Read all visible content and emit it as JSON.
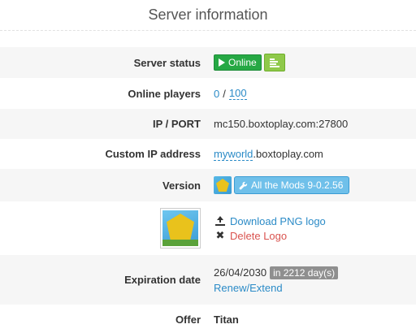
{
  "page_title": "Server information",
  "rows": {
    "server_status": {
      "label": "Server status",
      "status_text": "Online"
    },
    "online_players": {
      "label": "Online players",
      "current": "0",
      "separator": "/",
      "max": "100"
    },
    "ip_port": {
      "label": "IP / PORT",
      "value": "mc150.boxtoplay.com:27800"
    },
    "custom_ip": {
      "label": "Custom IP address",
      "subdomain": "myworld",
      "domain_suffix": ".boxtoplay.com"
    },
    "version": {
      "label": "Version",
      "modpack": "All the Mods 9-0.2.56"
    },
    "logo": {
      "download_label": "Download PNG logo",
      "delete_label": "Delete Logo"
    },
    "expiration": {
      "label": "Expiration date",
      "date": "26/04/2030",
      "days_badge": "in 2212 day(s)",
      "renew_label": "Renew/Extend"
    },
    "offer": {
      "label": "Offer",
      "value": "Titan"
    }
  },
  "icons": {
    "status": "play-icon",
    "console": "console-icon",
    "version_tool": "wrench-icon",
    "download": "upload-icon",
    "delete": "close-icon"
  },
  "colors": {
    "online_green": "#26a844",
    "console_green": "#8fc94a",
    "link_blue": "#2b8bc7",
    "version_blue": "#6fc0ea",
    "delete_red": "#d9534f",
    "badge_gray": "#8f8f8f"
  }
}
